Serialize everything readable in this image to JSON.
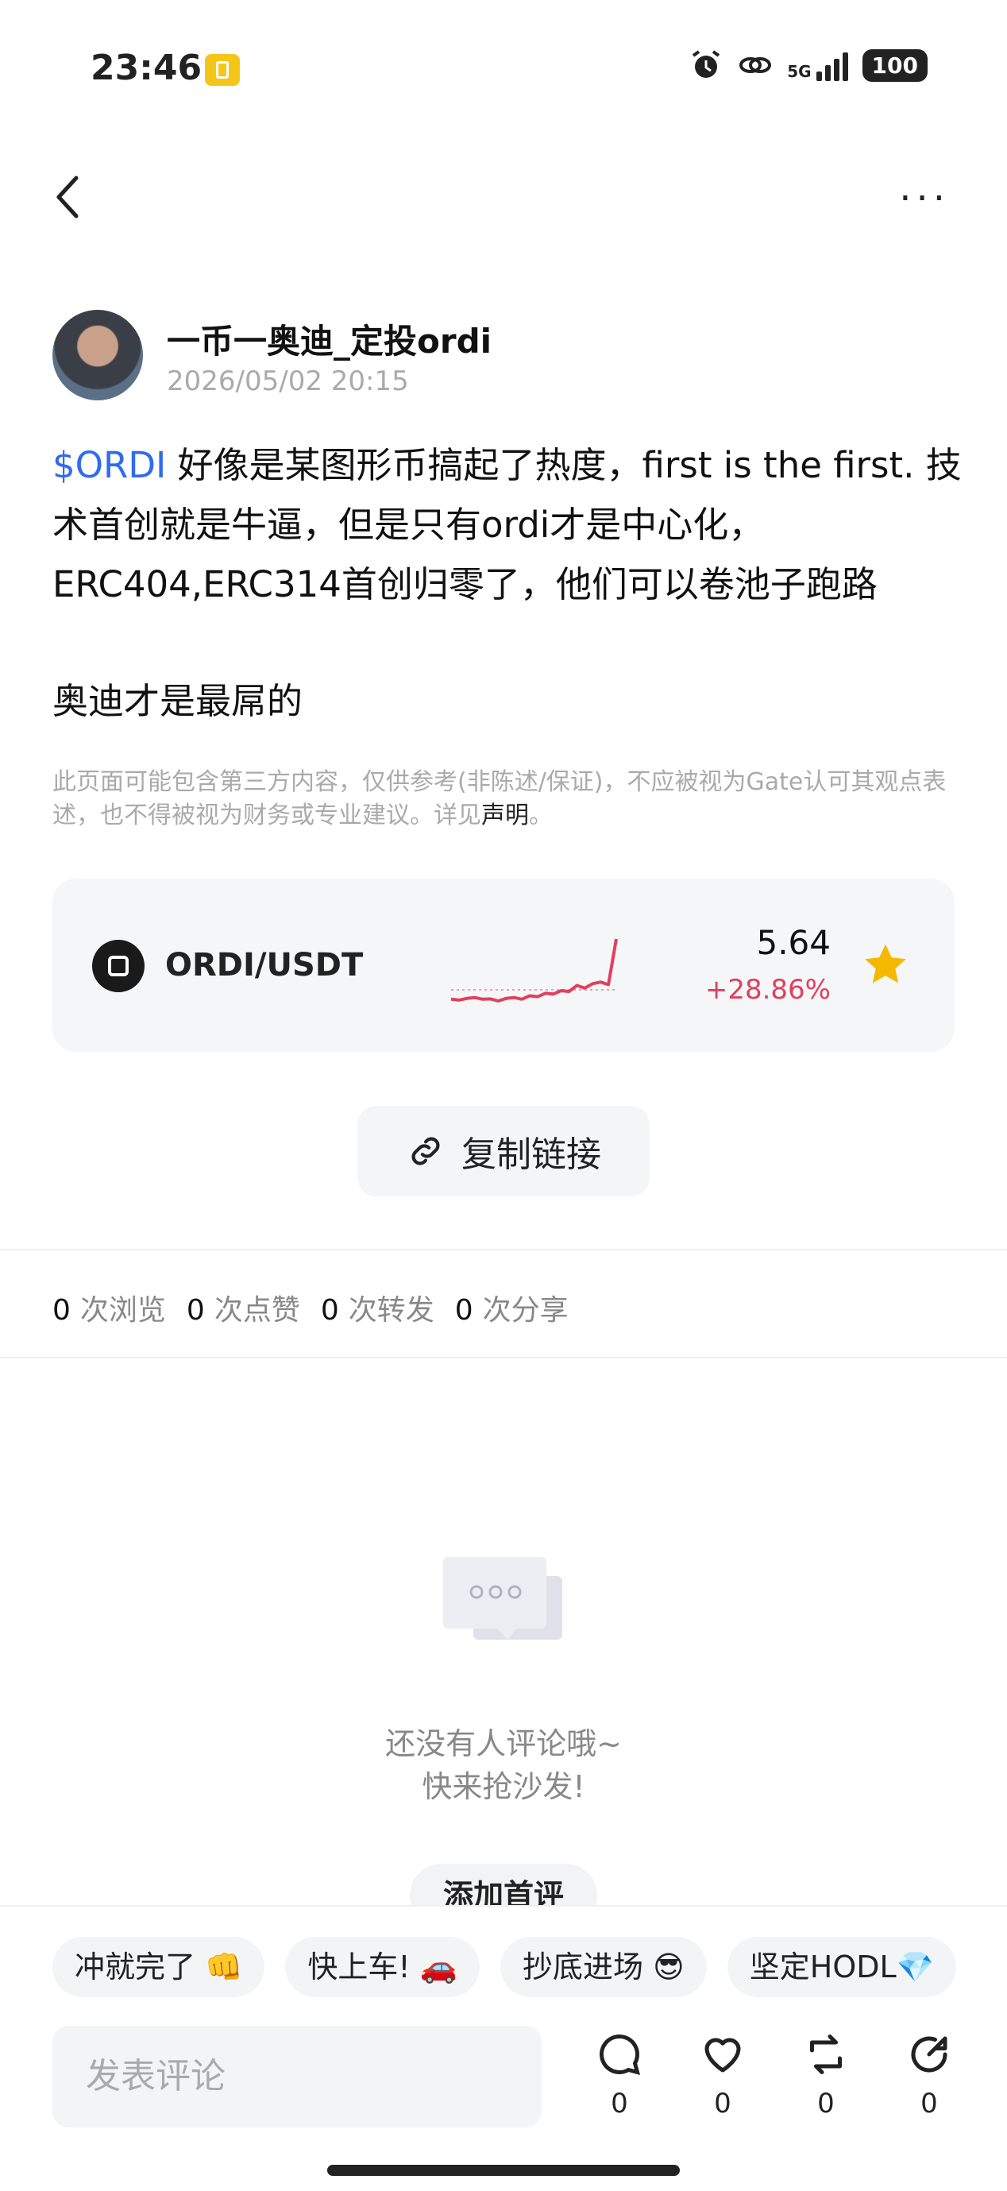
{
  "status_bar": {
    "time": "23:46",
    "network": "5G",
    "battery": "100"
  },
  "post": {
    "author": "一币一奥迪_定投ordi",
    "date": "2026/05/02 20:15",
    "tag": "$ORDI",
    "text": " 好像是某图形币搞起了热度，first is the first. 技术首创就是牛逼，但是只有ordi才是中心化，ERC404,ERC314首创归零了，他们可以卷池子跑路",
    "text2": "奥迪才是最屌的",
    "disclaimer": "此页面可能包含第三方内容，仅供参考(非陈述/保证)，不应被视为Gate认可其观点表述，也不得被视为财务或专业建议。详见",
    "disclaimer_link": "声明",
    "disclaimer_end": "。"
  },
  "ticker": {
    "pair": "ORDI/USDT",
    "price": "5.64",
    "change": "+28.86%",
    "change_color": "#e0405e",
    "sparkline": [
      1.0,
      0.95,
      1.05,
      1.1,
      1.0,
      1.02,
      0.9,
      1.05,
      1.1,
      1.0,
      1.2,
      1.15,
      1.35,
      1.3,
      1.5,
      1.45,
      1.8,
      1.65,
      1.9,
      2.0,
      1.85,
      4.5
    ]
  },
  "copy_link_label": "复制链接",
  "stats": [
    {
      "count": "0",
      "label": "次浏览"
    },
    {
      "count": "0",
      "label": "次点赞"
    },
    {
      "count": "0",
      "label": "次转发"
    },
    {
      "count": "0",
      "label": "次分享"
    }
  ],
  "empty": {
    "line1": "还没有人评论哦~",
    "line2": "快来抢沙发!",
    "button": "添加首评"
  },
  "chips": [
    "冲就完了 👊",
    "快上车! 🚗",
    "抄底进场 😎",
    "坚定HODL💎"
  ],
  "comment_placeholder": "发表评论",
  "actions": [
    {
      "icon": "comment-icon",
      "count": "0"
    },
    {
      "icon": "like-icon",
      "count": "0"
    },
    {
      "icon": "repost-icon",
      "count": "0"
    },
    {
      "icon": "share-icon",
      "count": "0"
    }
  ]
}
